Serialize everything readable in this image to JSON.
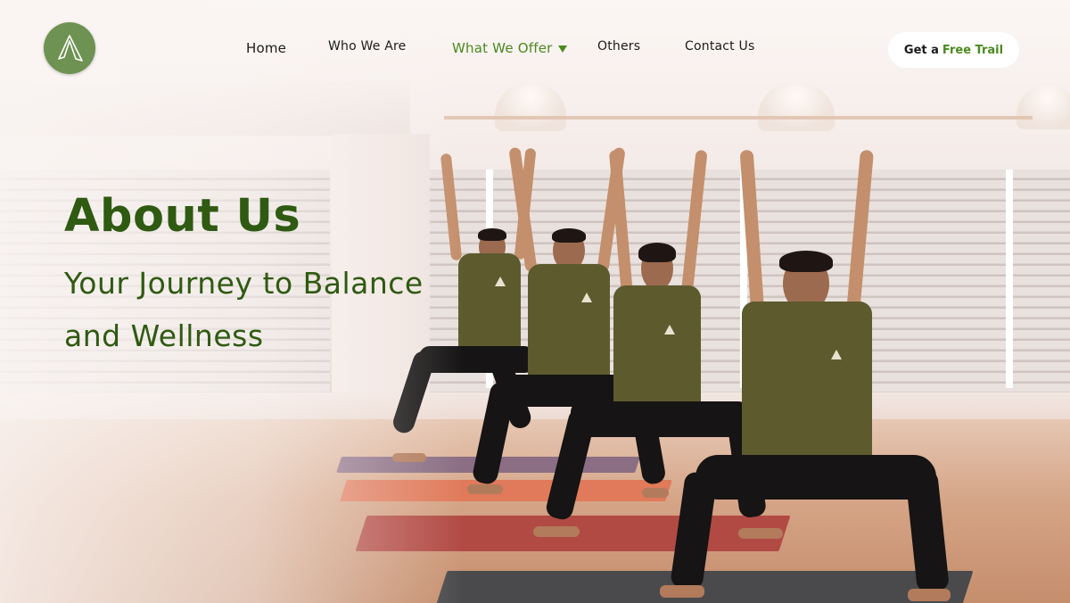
{
  "brand": {
    "logo_icon": "mountain-peak-icon",
    "accent": "#4a8a1f",
    "badge_color": "#6e9252"
  },
  "nav": {
    "items": [
      {
        "label": "Home"
      },
      {
        "label": "Who We Are"
      },
      {
        "label": "What We Offer",
        "active": true,
        "has_dropdown": true
      },
      {
        "label": "Others"
      },
      {
        "label": "Contact Us"
      }
    ]
  },
  "cta": {
    "prefix": "Get a",
    "highlight": "Free Trail"
  },
  "hero": {
    "title": "About Us",
    "subtitle": "Your Journey to Balance and Wellness",
    "text_color": "#2f5a12"
  }
}
